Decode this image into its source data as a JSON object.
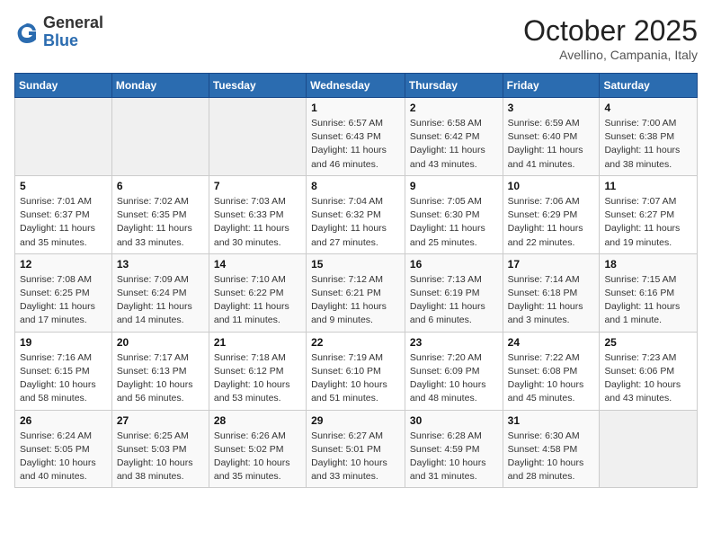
{
  "header": {
    "logo_general": "General",
    "logo_blue": "Blue",
    "month": "October 2025",
    "location": "Avellino, Campania, Italy"
  },
  "weekdays": [
    "Sunday",
    "Monday",
    "Tuesday",
    "Wednesday",
    "Thursday",
    "Friday",
    "Saturday"
  ],
  "weeks": [
    [
      {
        "day": "",
        "info": ""
      },
      {
        "day": "",
        "info": ""
      },
      {
        "day": "",
        "info": ""
      },
      {
        "day": "1",
        "info": "Sunrise: 6:57 AM\nSunset: 6:43 PM\nDaylight: 11 hours and 46 minutes."
      },
      {
        "day": "2",
        "info": "Sunrise: 6:58 AM\nSunset: 6:42 PM\nDaylight: 11 hours and 43 minutes."
      },
      {
        "day": "3",
        "info": "Sunrise: 6:59 AM\nSunset: 6:40 PM\nDaylight: 11 hours and 41 minutes."
      },
      {
        "day": "4",
        "info": "Sunrise: 7:00 AM\nSunset: 6:38 PM\nDaylight: 11 hours and 38 minutes."
      }
    ],
    [
      {
        "day": "5",
        "info": "Sunrise: 7:01 AM\nSunset: 6:37 PM\nDaylight: 11 hours and 35 minutes."
      },
      {
        "day": "6",
        "info": "Sunrise: 7:02 AM\nSunset: 6:35 PM\nDaylight: 11 hours and 33 minutes."
      },
      {
        "day": "7",
        "info": "Sunrise: 7:03 AM\nSunset: 6:33 PM\nDaylight: 11 hours and 30 minutes."
      },
      {
        "day": "8",
        "info": "Sunrise: 7:04 AM\nSunset: 6:32 PM\nDaylight: 11 hours and 27 minutes."
      },
      {
        "day": "9",
        "info": "Sunrise: 7:05 AM\nSunset: 6:30 PM\nDaylight: 11 hours and 25 minutes."
      },
      {
        "day": "10",
        "info": "Sunrise: 7:06 AM\nSunset: 6:29 PM\nDaylight: 11 hours and 22 minutes."
      },
      {
        "day": "11",
        "info": "Sunrise: 7:07 AM\nSunset: 6:27 PM\nDaylight: 11 hours and 19 minutes."
      }
    ],
    [
      {
        "day": "12",
        "info": "Sunrise: 7:08 AM\nSunset: 6:25 PM\nDaylight: 11 hours and 17 minutes."
      },
      {
        "day": "13",
        "info": "Sunrise: 7:09 AM\nSunset: 6:24 PM\nDaylight: 11 hours and 14 minutes."
      },
      {
        "day": "14",
        "info": "Sunrise: 7:10 AM\nSunset: 6:22 PM\nDaylight: 11 hours and 11 minutes."
      },
      {
        "day": "15",
        "info": "Sunrise: 7:12 AM\nSunset: 6:21 PM\nDaylight: 11 hours and 9 minutes."
      },
      {
        "day": "16",
        "info": "Sunrise: 7:13 AM\nSunset: 6:19 PM\nDaylight: 11 hours and 6 minutes."
      },
      {
        "day": "17",
        "info": "Sunrise: 7:14 AM\nSunset: 6:18 PM\nDaylight: 11 hours and 3 minutes."
      },
      {
        "day": "18",
        "info": "Sunrise: 7:15 AM\nSunset: 6:16 PM\nDaylight: 11 hours and 1 minute."
      }
    ],
    [
      {
        "day": "19",
        "info": "Sunrise: 7:16 AM\nSunset: 6:15 PM\nDaylight: 10 hours and 58 minutes."
      },
      {
        "day": "20",
        "info": "Sunrise: 7:17 AM\nSunset: 6:13 PM\nDaylight: 10 hours and 56 minutes."
      },
      {
        "day": "21",
        "info": "Sunrise: 7:18 AM\nSunset: 6:12 PM\nDaylight: 10 hours and 53 minutes."
      },
      {
        "day": "22",
        "info": "Sunrise: 7:19 AM\nSunset: 6:10 PM\nDaylight: 10 hours and 51 minutes."
      },
      {
        "day": "23",
        "info": "Sunrise: 7:20 AM\nSunset: 6:09 PM\nDaylight: 10 hours and 48 minutes."
      },
      {
        "day": "24",
        "info": "Sunrise: 7:22 AM\nSunset: 6:08 PM\nDaylight: 10 hours and 45 minutes."
      },
      {
        "day": "25",
        "info": "Sunrise: 7:23 AM\nSunset: 6:06 PM\nDaylight: 10 hours and 43 minutes."
      }
    ],
    [
      {
        "day": "26",
        "info": "Sunrise: 6:24 AM\nSunset: 5:05 PM\nDaylight: 10 hours and 40 minutes."
      },
      {
        "day": "27",
        "info": "Sunrise: 6:25 AM\nSunset: 5:03 PM\nDaylight: 10 hours and 38 minutes."
      },
      {
        "day": "28",
        "info": "Sunrise: 6:26 AM\nSunset: 5:02 PM\nDaylight: 10 hours and 35 minutes."
      },
      {
        "day": "29",
        "info": "Sunrise: 6:27 AM\nSunset: 5:01 PM\nDaylight: 10 hours and 33 minutes."
      },
      {
        "day": "30",
        "info": "Sunrise: 6:28 AM\nSunset: 4:59 PM\nDaylight: 10 hours and 31 minutes."
      },
      {
        "day": "31",
        "info": "Sunrise: 6:30 AM\nSunset: 4:58 PM\nDaylight: 10 hours and 28 minutes."
      },
      {
        "day": "",
        "info": ""
      }
    ]
  ]
}
